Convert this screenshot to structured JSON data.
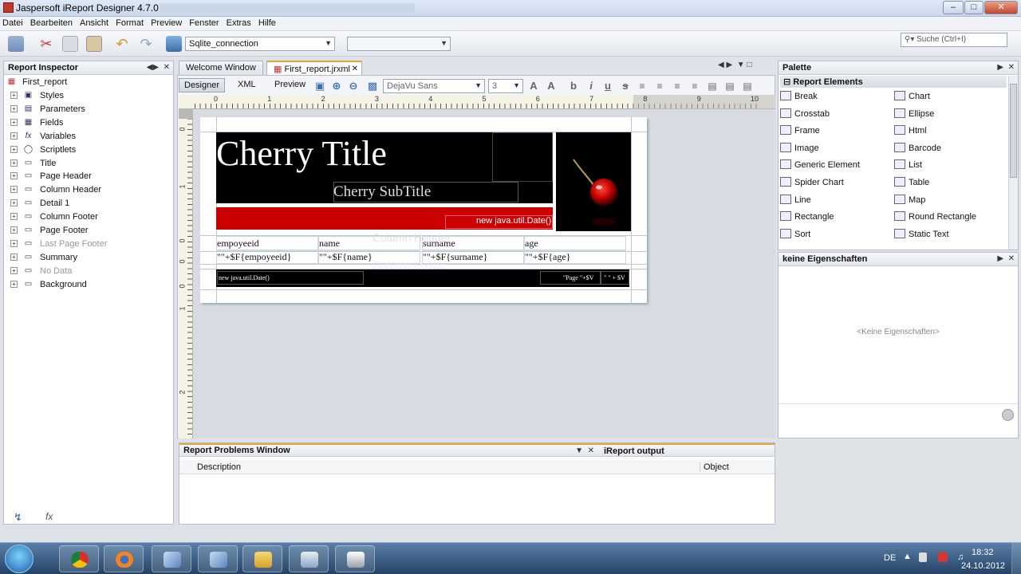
{
  "window": {
    "title": "Jaspersoft iReport Designer 4.7.0"
  },
  "menu": [
    "Datei",
    "Bearbeiten",
    "Ansicht",
    "Format",
    "Preview",
    "Fenster",
    "Extras",
    "Hilfe"
  ],
  "toolbar": {
    "connection": "Sqlite_connection",
    "search_placeholder": "Suche (Ctrl+I)"
  },
  "inspector": {
    "title": "Report Inspector",
    "root": "First_report",
    "items": [
      {
        "label": "Styles",
        "icon": "styles-icon",
        "dim": false
      },
      {
        "label": "Parameters",
        "icon": "parameters-icon",
        "dim": false
      },
      {
        "label": "Fields",
        "icon": "fields-icon",
        "dim": false
      },
      {
        "label": "Variables",
        "icon": "variables-icon",
        "dim": false
      },
      {
        "label": "Scriptlets",
        "icon": "scriptlets-icon",
        "dim": false
      },
      {
        "label": "Title",
        "icon": "band-icon",
        "dim": false
      },
      {
        "label": "Page Header",
        "icon": "band-icon",
        "dim": false
      },
      {
        "label": "Column Header",
        "icon": "band-icon",
        "dim": false
      },
      {
        "label": "Detail 1",
        "icon": "band-icon",
        "dim": false
      },
      {
        "label": "Column Footer",
        "icon": "band-icon",
        "dim": false
      },
      {
        "label": "Page Footer",
        "icon": "band-icon",
        "dim": false
      },
      {
        "label": "Last Page Footer",
        "icon": "band-icon",
        "dim": true
      },
      {
        "label": "Summary",
        "icon": "band-icon",
        "dim": false
      },
      {
        "label": "No Data",
        "icon": "band-icon",
        "dim": true
      },
      {
        "label": "Background",
        "icon": "band-icon",
        "dim": false
      }
    ]
  },
  "editor": {
    "tabs": [
      {
        "label": "Welcome Window"
      },
      {
        "label": "First_report.jrxml"
      }
    ],
    "views": {
      "designer": "Designer",
      "xml": "XML",
      "preview": "Preview"
    },
    "font_name": "DejaVu Sans",
    "font_size": "3",
    "ruler": [
      "0",
      "1",
      "2",
      "3",
      "4",
      "5",
      "6",
      "7",
      "8",
      "9",
      "10"
    ],
    "vruler": [
      "0",
      "1",
      "0",
      "0",
      "0",
      "1",
      "2"
    ]
  },
  "report": {
    "title": "Cherry Title",
    "subtitle": "Cherry SubTitle",
    "date_expr": "new java.util.Date()",
    "column_header_ghost": "Column Header",
    "column_footer_ghost": "Column Footer",
    "columns": [
      "empoyeeid",
      "name",
      "surname",
      "age"
    ],
    "fields": [
      "\"\"+$F{empoyeeid}",
      "\"\"+$F{name}",
      "\"\"+$F{surname}",
      "\"\"+$F{age}"
    ],
    "footer_date": "new java.util.Date()",
    "footer_page": "\"Page \"+$V",
    "footer_page2": "\" \" + $V",
    "accent_red": "#cc0000",
    "band_black": "#000000"
  },
  "problems": {
    "title": "Report Problems Window",
    "output_tab": "iReport output",
    "col_description": "Description",
    "col_object": "Object"
  },
  "palette": {
    "title": "Palette",
    "section": "Report Elements",
    "left": [
      "Break",
      "Crosstab",
      "Frame",
      "Image",
      "Generic Element",
      "Spider Chart",
      "Line",
      "Rectangle",
      "Sort"
    ],
    "right": [
      "Chart",
      "Ellipse",
      "Html",
      "Barcode",
      "List",
      "Table",
      "Map",
      "Round Rectangle",
      "Static Text"
    ]
  },
  "properties": {
    "title": "keine Eigenschaften",
    "empty": "<Keine Eigenschaften>"
  },
  "taskbar": {
    "lang": "DE",
    "time": "18:32",
    "date": "24.10.2012"
  }
}
